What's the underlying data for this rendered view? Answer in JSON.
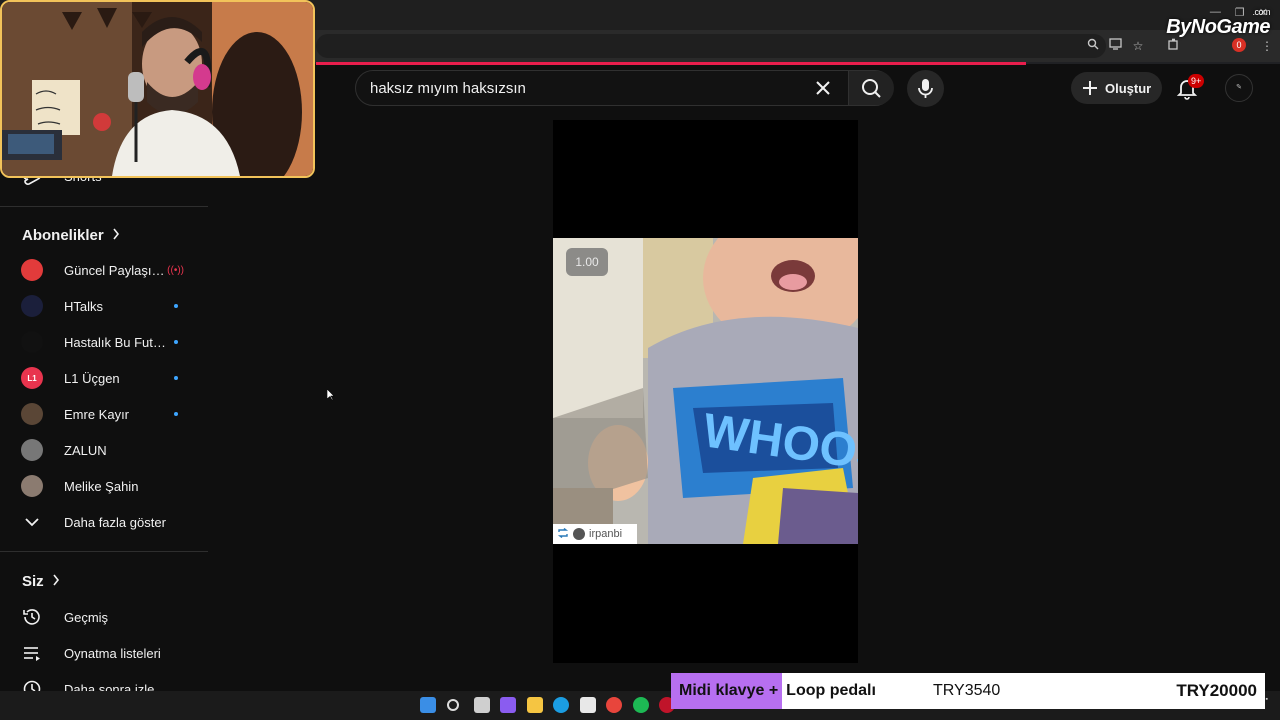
{
  "search": {
    "query": "haksız mıyım haksızsın"
  },
  "header": {
    "create_label": "Oluştur",
    "notif_badge": "9+"
  },
  "watermark": {
    "brand": "ByNoGame",
    "suffix": ".com"
  },
  "browser": {
    "profile_badge": "0"
  },
  "sidebar": {
    "shorts_label": "Shorts",
    "subscriptions_heading": "Abonelikler",
    "subscriptions": [
      {
        "label": "Güncel Paylaşım...",
        "avatar_color": "#e23b3b",
        "status": "live"
      },
      {
        "label": "HTalks",
        "avatar_color": "#1b1f3b",
        "status": "new"
      },
      {
        "label": "Hastalık Bu Futbol",
        "avatar_color": "#111111",
        "status": "new"
      },
      {
        "label": "L1 Üçgen",
        "avatar_color": "#e8344e",
        "avatar_text": "L1",
        "status": "new"
      },
      {
        "label": "Emre Kayır",
        "avatar_color": "#5a4636",
        "status": "new"
      },
      {
        "label": "ZALUN",
        "avatar_color": "#777777",
        "status": "none"
      },
      {
        "label": "Melike Şahin",
        "avatar_color": "#8b7b70",
        "status": "none"
      }
    ],
    "show_more_label": "Daha fazla göster",
    "you_heading": "Siz",
    "you_items": [
      {
        "label": "Geçmiş",
        "icon": "history-icon"
      },
      {
        "label": "Oynatma listeleri",
        "icon": "playlist-icon"
      },
      {
        "label": "Daha sonra izle",
        "icon": "watch-later-icon"
      }
    ]
  },
  "player": {
    "speed": "1.00",
    "repost_user": "irpanbi"
  },
  "donation": {
    "item_highlight": "Midi klavye +",
    "item_rest": "Loop pedalı",
    "price": "TRY3540",
    "goal": "TRY20000"
  },
  "colors": {
    "accent": "#e91e4d",
    "webcam_border": "#f2c35a",
    "donation_highlight": "#b76ff0",
    "subscription_dot": "#3ea6ff"
  }
}
